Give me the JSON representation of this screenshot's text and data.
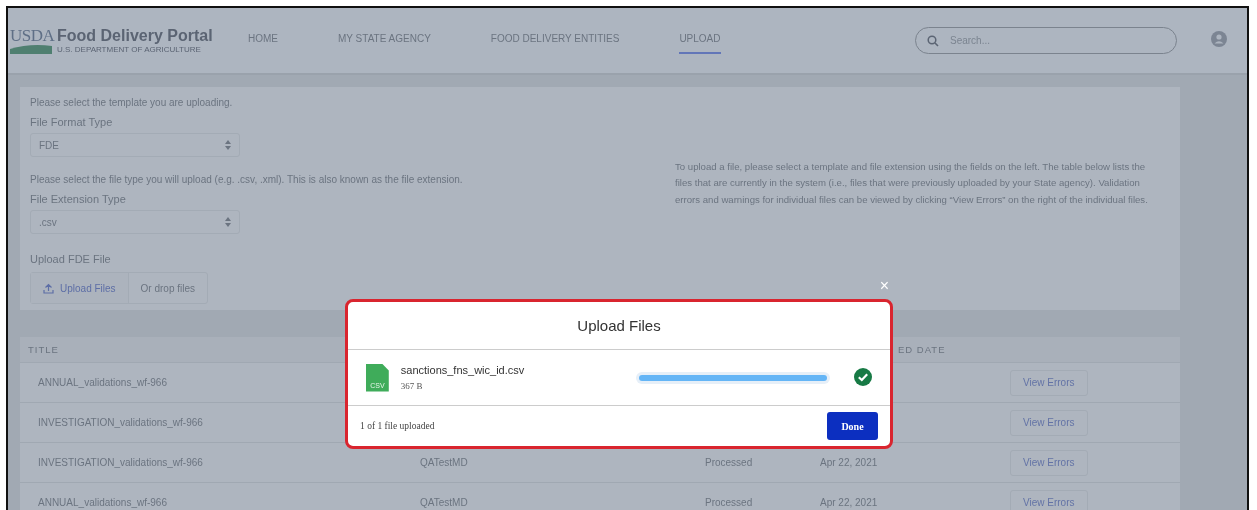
{
  "header": {
    "logo_mark": "USDA",
    "title": "Food Delivery Portal",
    "subtitle": "U.S. DEPARTMENT OF AGRICULTURE",
    "nav": [
      {
        "label": "HOME",
        "selected": false
      },
      {
        "label": "MY STATE AGENCY",
        "selected": false
      },
      {
        "label": "FOOD DELIVERY ENTITIES",
        "selected": false
      },
      {
        "label": "UPLOAD",
        "selected": true
      }
    ],
    "search": {
      "placeholder": "Search..."
    }
  },
  "upload_form": {
    "template_prompt": "Please select the template you are uploading.",
    "format_label": "File Format Type",
    "format_value": "FDE",
    "extension_prompt": "Please select the file type you will upload (e.g. .csv, .xml). This is also known as the file extension.",
    "extension_label": "File Extension Type",
    "extension_value": ".csv",
    "upload_label": "Upload FDE File",
    "upload_button": "Upload Files",
    "drop_hint": "Or drop files",
    "instructions": "To upload a file, please select a template and file extension using the fields on the left. The table below lists the files that are currently in the system (i.e., files that were previously uploaded by your State agency). Validation errors and warnings for individual files can be viewed by clicking “View Errors” on the right of the individual files."
  },
  "table": {
    "columns": [
      "TITLE",
      "ED DATE"
    ],
    "rows": [
      {
        "title": "ANNUAL_validations_wf-966",
        "action": "View Errors"
      },
      {
        "title": "INVESTIGATION_validations_wf-966",
        "action": "View Errors"
      },
      {
        "title": "INVESTIGATION_validations_wf-966",
        "column_2": "QATestMD",
        "status": "Processed",
        "date": "Apr 22, 2021",
        "action": "View Errors"
      },
      {
        "title": "ANNUAL_validations_wf-966",
        "column_2": "QATestMD",
        "status": "Processed",
        "date": "Apr 22, 2021",
        "action": "View Errors"
      }
    ]
  },
  "modal": {
    "close": "×",
    "title": "Upload Files",
    "files": [
      {
        "type_badge": "CSV",
        "name": "sanctions_fns_wic_id.csv",
        "size": "367 B",
        "level": 1,
        "done": true
      }
    ],
    "summary": "1 of 1 file uploaded",
    "button": "Done"
  }
}
